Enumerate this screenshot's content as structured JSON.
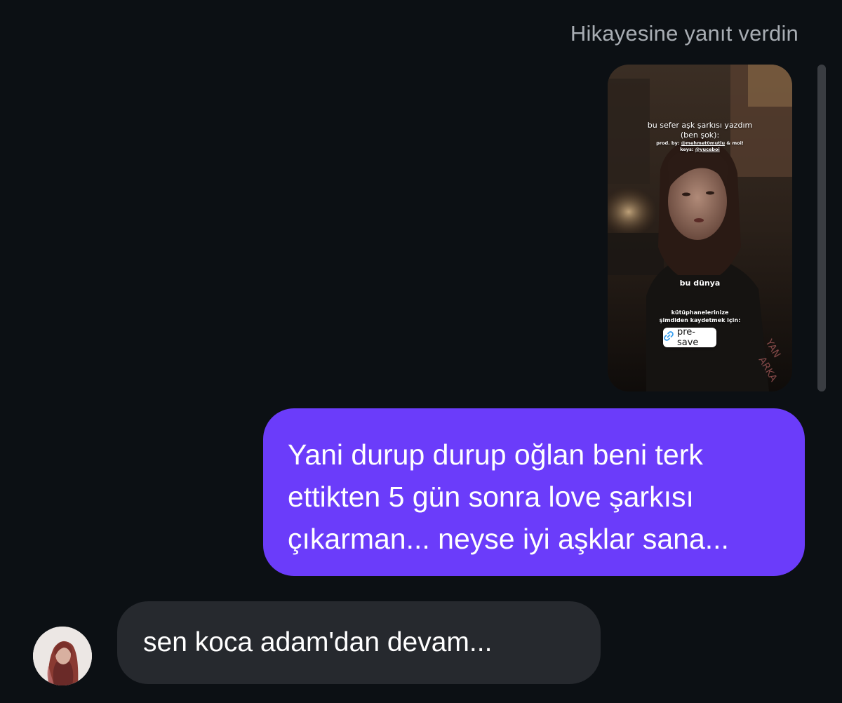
{
  "header": {
    "reply_label": "Hikayesine yanıt verdin"
  },
  "story": {
    "title_line1": "bu sefer aşk şarkısı yazdım",
    "title_line2": "(ben şok):",
    "credits_prefix": "prod. by: ",
    "credits_handle1": "@mehmet0mutlu",
    "credits_middle": " & moi!",
    "credits_keys_prefix": "keys: ",
    "credits_handle2": "@yuceboi",
    "song_name": "bu dünya",
    "cta_line1": "kütüphanelerinize",
    "cta_line2": "şimdiden kaydetmek için:",
    "button_label": "pre-save",
    "button_icon": "link-icon"
  },
  "messages": {
    "outgoing_lines": [
      "Yani durup durup oğlan beni terk",
      "ettikten 5 gün sonra love şarkısı",
      "çıkarman... neyse iyi aşklar sana..."
    ],
    "incoming_text": "sen koca adam'dan devam..."
  },
  "colors": {
    "background": "#0c1014",
    "outgoing_bubble": "#6b3cfa",
    "incoming_bubble": "#26292e",
    "meta_text": "#a8adb3"
  }
}
